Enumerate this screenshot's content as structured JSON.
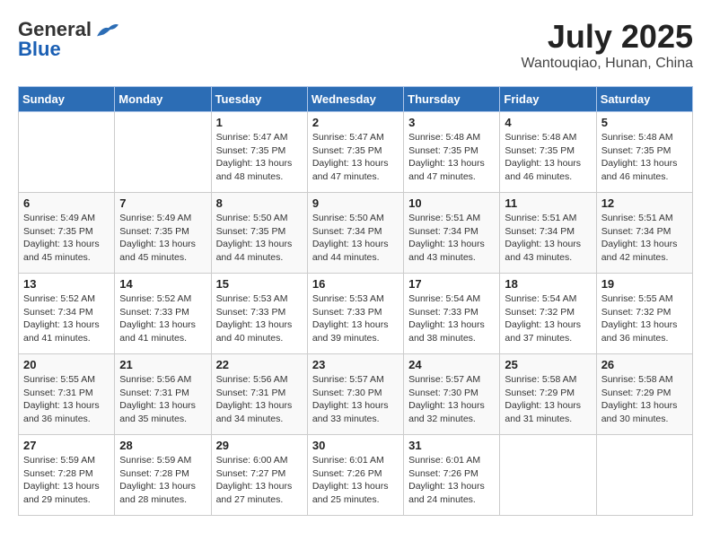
{
  "header": {
    "logo_general": "General",
    "logo_blue": "Blue",
    "month": "July 2025",
    "location": "Wantouqiao, Hunan, China"
  },
  "weekdays": [
    "Sunday",
    "Monday",
    "Tuesday",
    "Wednesday",
    "Thursday",
    "Friday",
    "Saturday"
  ],
  "weeks": [
    [
      {
        "day": "",
        "info": ""
      },
      {
        "day": "",
        "info": ""
      },
      {
        "day": "1",
        "info": "Sunrise: 5:47 AM\nSunset: 7:35 PM\nDaylight: 13 hours and 48 minutes."
      },
      {
        "day": "2",
        "info": "Sunrise: 5:47 AM\nSunset: 7:35 PM\nDaylight: 13 hours and 47 minutes."
      },
      {
        "day": "3",
        "info": "Sunrise: 5:48 AM\nSunset: 7:35 PM\nDaylight: 13 hours and 47 minutes."
      },
      {
        "day": "4",
        "info": "Sunrise: 5:48 AM\nSunset: 7:35 PM\nDaylight: 13 hours and 46 minutes."
      },
      {
        "day": "5",
        "info": "Sunrise: 5:48 AM\nSunset: 7:35 PM\nDaylight: 13 hours and 46 minutes."
      }
    ],
    [
      {
        "day": "6",
        "info": "Sunrise: 5:49 AM\nSunset: 7:35 PM\nDaylight: 13 hours and 45 minutes."
      },
      {
        "day": "7",
        "info": "Sunrise: 5:49 AM\nSunset: 7:35 PM\nDaylight: 13 hours and 45 minutes."
      },
      {
        "day": "8",
        "info": "Sunrise: 5:50 AM\nSunset: 7:35 PM\nDaylight: 13 hours and 44 minutes."
      },
      {
        "day": "9",
        "info": "Sunrise: 5:50 AM\nSunset: 7:34 PM\nDaylight: 13 hours and 44 minutes."
      },
      {
        "day": "10",
        "info": "Sunrise: 5:51 AM\nSunset: 7:34 PM\nDaylight: 13 hours and 43 minutes."
      },
      {
        "day": "11",
        "info": "Sunrise: 5:51 AM\nSunset: 7:34 PM\nDaylight: 13 hours and 43 minutes."
      },
      {
        "day": "12",
        "info": "Sunrise: 5:51 AM\nSunset: 7:34 PM\nDaylight: 13 hours and 42 minutes."
      }
    ],
    [
      {
        "day": "13",
        "info": "Sunrise: 5:52 AM\nSunset: 7:34 PM\nDaylight: 13 hours and 41 minutes."
      },
      {
        "day": "14",
        "info": "Sunrise: 5:52 AM\nSunset: 7:33 PM\nDaylight: 13 hours and 41 minutes."
      },
      {
        "day": "15",
        "info": "Sunrise: 5:53 AM\nSunset: 7:33 PM\nDaylight: 13 hours and 40 minutes."
      },
      {
        "day": "16",
        "info": "Sunrise: 5:53 AM\nSunset: 7:33 PM\nDaylight: 13 hours and 39 minutes."
      },
      {
        "day": "17",
        "info": "Sunrise: 5:54 AM\nSunset: 7:33 PM\nDaylight: 13 hours and 38 minutes."
      },
      {
        "day": "18",
        "info": "Sunrise: 5:54 AM\nSunset: 7:32 PM\nDaylight: 13 hours and 37 minutes."
      },
      {
        "day": "19",
        "info": "Sunrise: 5:55 AM\nSunset: 7:32 PM\nDaylight: 13 hours and 36 minutes."
      }
    ],
    [
      {
        "day": "20",
        "info": "Sunrise: 5:55 AM\nSunset: 7:31 PM\nDaylight: 13 hours and 36 minutes."
      },
      {
        "day": "21",
        "info": "Sunrise: 5:56 AM\nSunset: 7:31 PM\nDaylight: 13 hours and 35 minutes."
      },
      {
        "day": "22",
        "info": "Sunrise: 5:56 AM\nSunset: 7:31 PM\nDaylight: 13 hours and 34 minutes."
      },
      {
        "day": "23",
        "info": "Sunrise: 5:57 AM\nSunset: 7:30 PM\nDaylight: 13 hours and 33 minutes."
      },
      {
        "day": "24",
        "info": "Sunrise: 5:57 AM\nSunset: 7:30 PM\nDaylight: 13 hours and 32 minutes."
      },
      {
        "day": "25",
        "info": "Sunrise: 5:58 AM\nSunset: 7:29 PM\nDaylight: 13 hours and 31 minutes."
      },
      {
        "day": "26",
        "info": "Sunrise: 5:58 AM\nSunset: 7:29 PM\nDaylight: 13 hours and 30 minutes."
      }
    ],
    [
      {
        "day": "27",
        "info": "Sunrise: 5:59 AM\nSunset: 7:28 PM\nDaylight: 13 hours and 29 minutes."
      },
      {
        "day": "28",
        "info": "Sunrise: 5:59 AM\nSunset: 7:28 PM\nDaylight: 13 hours and 28 minutes."
      },
      {
        "day": "29",
        "info": "Sunrise: 6:00 AM\nSunset: 7:27 PM\nDaylight: 13 hours and 27 minutes."
      },
      {
        "day": "30",
        "info": "Sunrise: 6:01 AM\nSunset: 7:26 PM\nDaylight: 13 hours and 25 minutes."
      },
      {
        "day": "31",
        "info": "Sunrise: 6:01 AM\nSunset: 7:26 PM\nDaylight: 13 hours and 24 minutes."
      },
      {
        "day": "",
        "info": ""
      },
      {
        "day": "",
        "info": ""
      }
    ]
  ]
}
